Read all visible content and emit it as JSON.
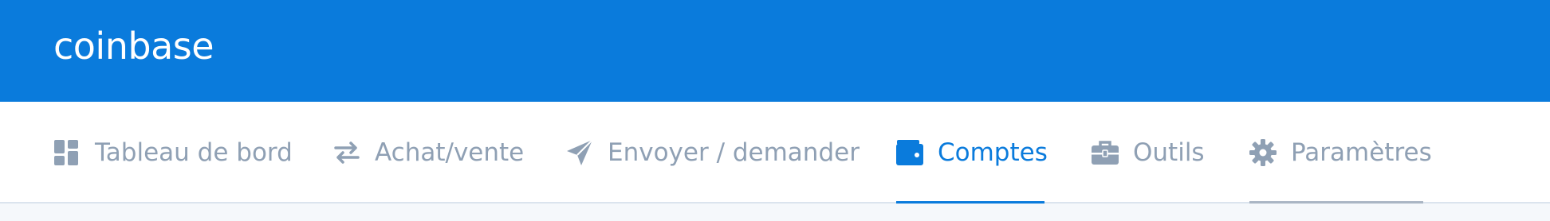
{
  "header": {
    "logo": "coinbase"
  },
  "nav": {
    "tabs": [
      {
        "label": "Tableau de bord",
        "icon": "dashboard-icon"
      },
      {
        "label": "Achat/vente",
        "icon": "swap-arrows-icon"
      },
      {
        "label": "Envoyer / demander",
        "icon": "paper-plane-icon"
      },
      {
        "label": "Comptes",
        "icon": "wallet-icon",
        "active": true
      },
      {
        "label": "Outils",
        "icon": "briefcase-icon"
      },
      {
        "label": "Paramètres",
        "icon": "gear-icon"
      }
    ]
  },
  "colors": {
    "brand": "#0a7bdc",
    "inactive_tab": "#8fa0b4",
    "header_bg": "#0a7bdc",
    "page_bg": "#f5f8fb"
  }
}
